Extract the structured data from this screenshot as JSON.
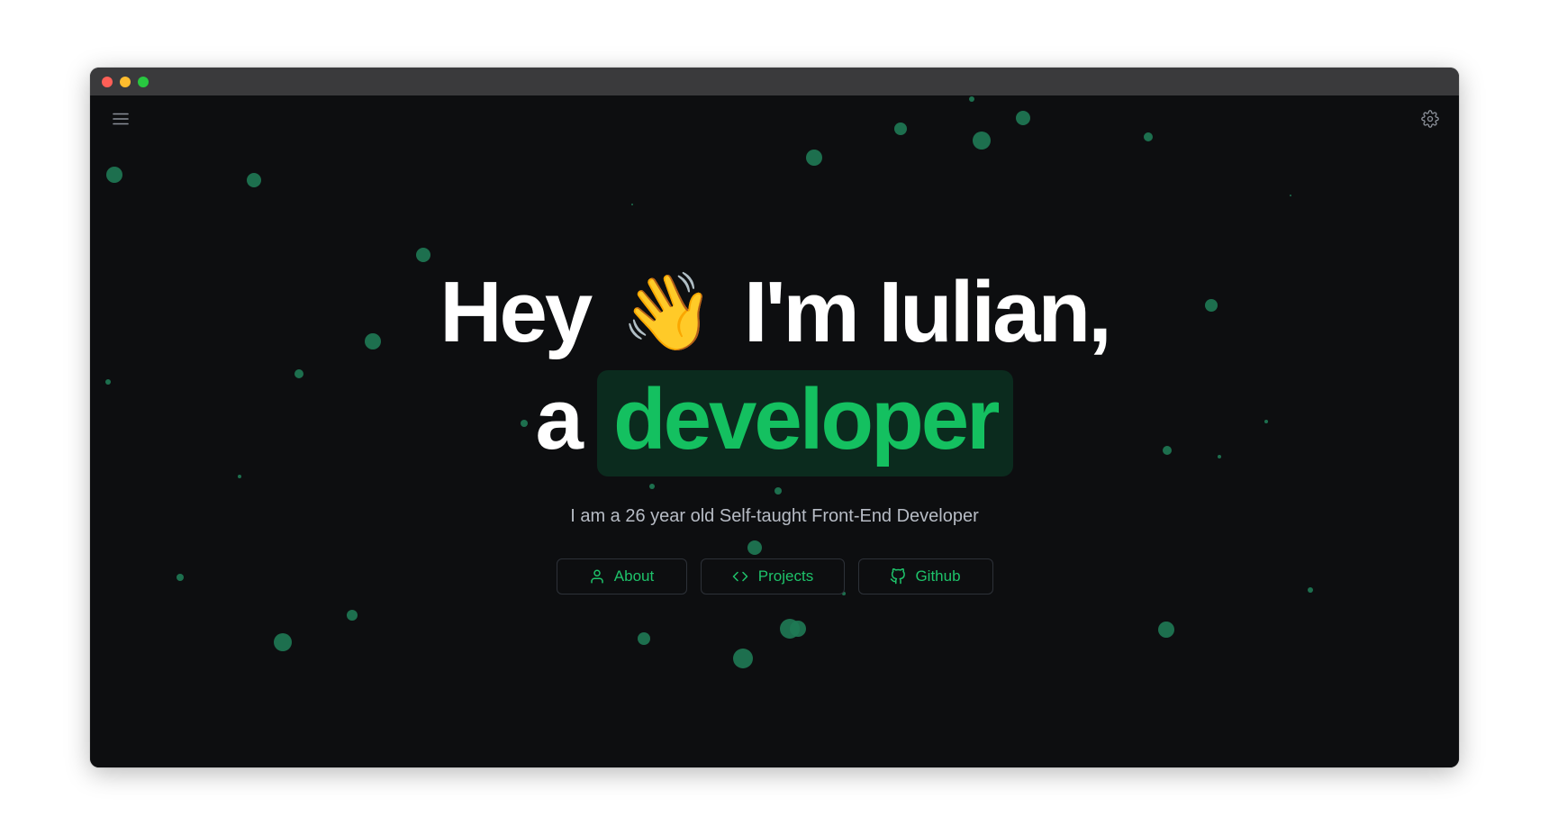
{
  "window": {
    "controls": [
      "close",
      "minimize",
      "maximize"
    ]
  },
  "header": {
    "menu_icon": "hamburger-menu-icon",
    "settings_icon": "gear-icon"
  },
  "hero": {
    "greeting": "Hey",
    "wave_emoji": "👋",
    "name_line": "I'm Iulian,",
    "article": "a",
    "role": "developer",
    "subtitle": "I am a 26 year old Self-taught Front-End Developer"
  },
  "buttons": [
    {
      "label": "About",
      "icon": "user-icon"
    },
    {
      "label": "Projects",
      "icon": "code-icon"
    },
    {
      "label": "Github",
      "icon": "github-icon"
    }
  ],
  "colors": {
    "background": "#0d0e10",
    "titlebar": "#3a3a3c",
    "accent": "#14c060",
    "highlight_bg": "#0b2b1e",
    "particle": "#1f7a55",
    "subtitle": "#b7bcc5"
  }
}
